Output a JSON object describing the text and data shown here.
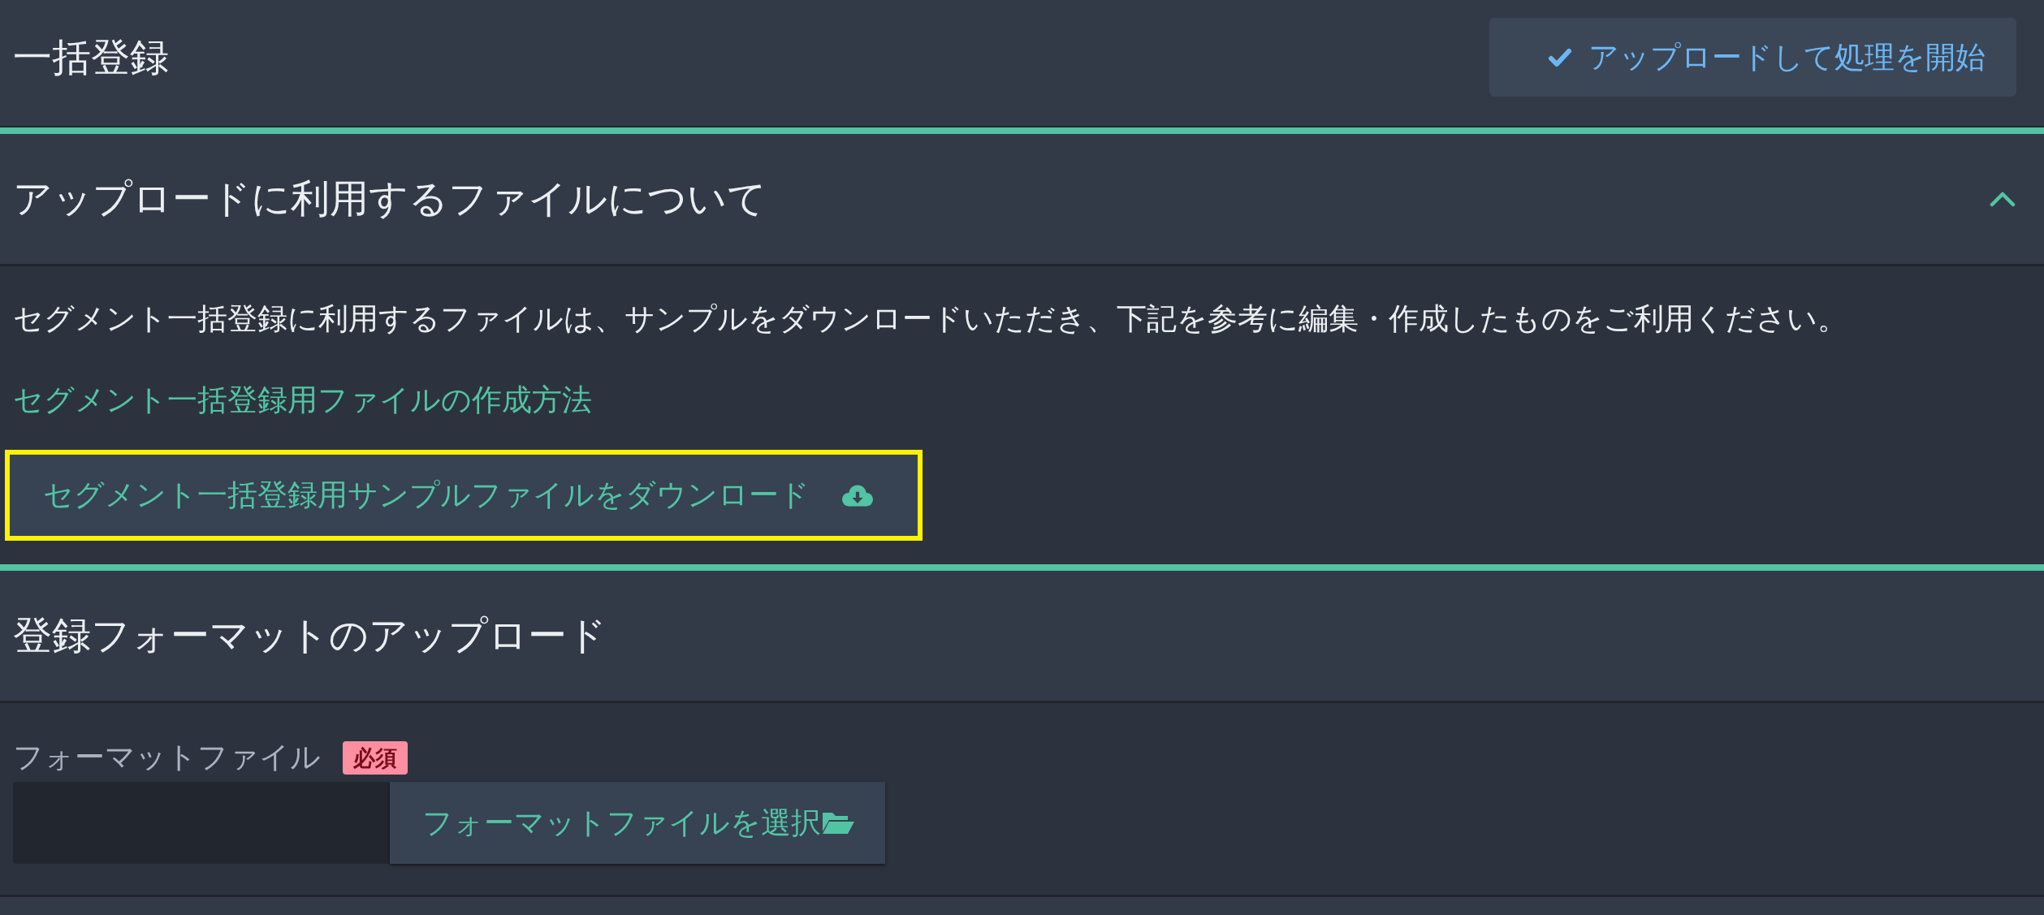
{
  "header": {
    "title": "一括登録",
    "start_button": "アップロードして処理を開始"
  },
  "sections": [
    {
      "kind": "info",
      "title": "アップロードに利用するファイルについて",
      "expanded": true,
      "description": "セグメント一括登録に利用するファイルは、サンプルをダウンロードいただき、下記を参考に編集・作成したものをご利用ください。",
      "link": "セグメント一括登録用ファイルの作成方法",
      "download_button": {
        "label": "セグメント一括登録用サンプルファイルをダウンロード",
        "highlighted": true
      }
    },
    {
      "kind": "upload",
      "title": "登録フォーマットのアップロード",
      "field": {
        "label": "フォーマットファイル",
        "badge": "必須",
        "button": "フォーマットファイルを選択"
      }
    }
  ]
}
